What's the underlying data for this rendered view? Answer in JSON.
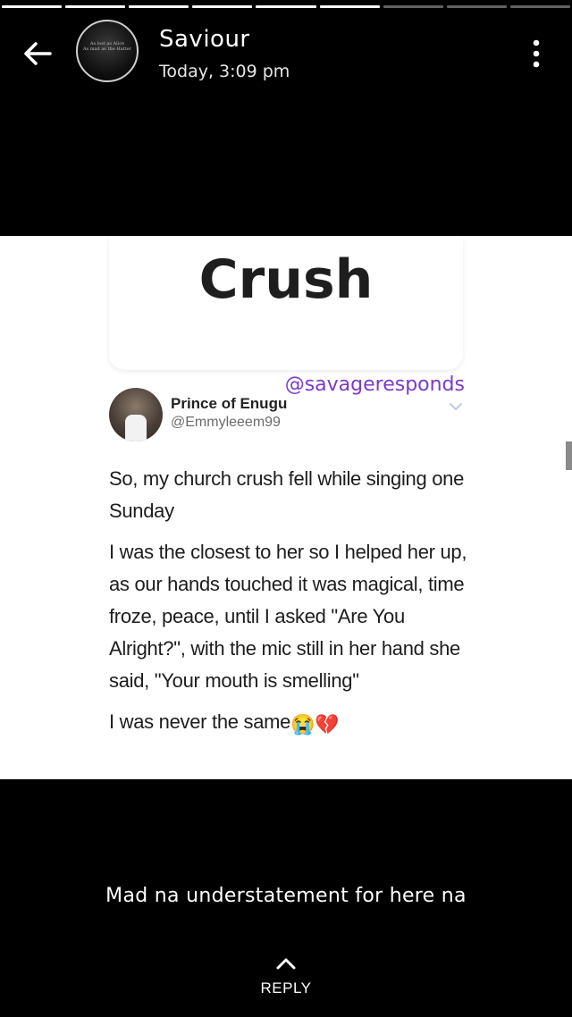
{
  "progress": {
    "total_segments": 9,
    "completed_segments": 6
  },
  "header": {
    "sender_name": "Saviour",
    "timestamp": "Today, 3:09 pm",
    "avatar_text_line1": "As lost as Alice",
    "avatar_text_line2": "As mad as the Hatter",
    "back_icon": "arrow-left-icon",
    "menu_icon": "more-vertical-icon"
  },
  "status_image": {
    "card_title": "Crush",
    "watermark": "@savageresponds",
    "tweet": {
      "author_name": "Prince of Enugu",
      "author_handle": "@Emmyleeem99",
      "paragraphs": [
        "So, my church crush fell while singing one Sunday",
        "I was the closest to her so I helped her up, as our hands touched it was magical, time froze, peace, until I asked \"Are You Alright?\", with the mic still in her hand she said, \"Your mouth is smelling\"",
        "I was never the same"
      ],
      "emojis": "😭💔"
    }
  },
  "caption": "Mad na understatement for here na",
  "reply": {
    "label": "REPLY",
    "icon": "chevron-up-icon"
  }
}
